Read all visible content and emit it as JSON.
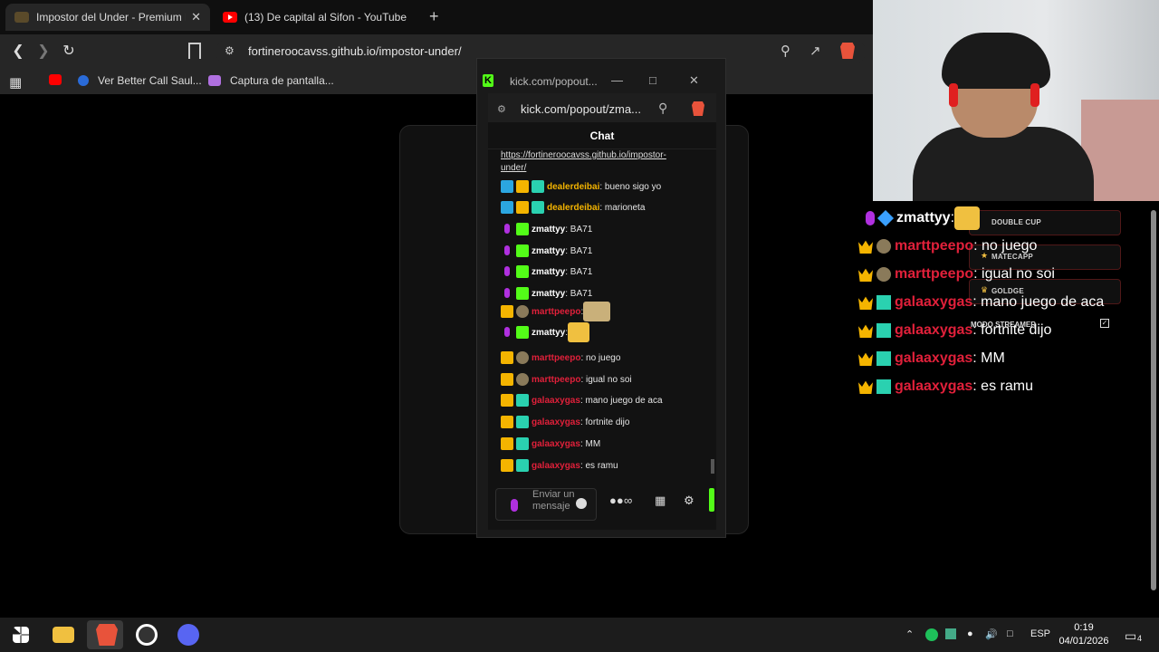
{
  "browser": {
    "tabs": [
      {
        "title": "Impostor del Under - Premium E",
        "close": "✕"
      },
      {
        "title": "(13) De capital al Sifon - YouTube"
      }
    ],
    "new_tab": "+",
    "url": "fortineroocavss.github.io/impostor-under/",
    "bookmarks": [
      {
        "label": "Ver Better Call Saul..."
      },
      {
        "label": "Captura de pantalla..."
      }
    ]
  },
  "popout": {
    "title": "kick.com/popout...",
    "url": "kick.com/popout/zma...",
    "chat_header": "Chat",
    "link_line1": "https://fortineroocavss.github.io/impostor-",
    "link_line2": "under/",
    "messages": [
      {
        "user": "dealerdeibai",
        "text": ": bueno sigo yo",
        "color": "#f4b400"
      },
      {
        "user": "dealerdeibai",
        "text": ": marioneta",
        "color": "#f4b400"
      },
      {
        "user": "zmattyy",
        "text": ": BA71",
        "color": "#ffffff"
      },
      {
        "user": "zmattyy",
        "text": ": BA71",
        "color": "#ffffff"
      },
      {
        "user": "zmattyy",
        "text": ": BA71",
        "color": "#ffffff"
      },
      {
        "user": "zmattyy",
        "text": ": BA71",
        "color": "#ffffff"
      },
      {
        "user": "marttpeepo",
        "text": ":",
        "color": "#e0203a"
      },
      {
        "user": "zmattyy",
        "text": ":",
        "color": "#ffffff"
      },
      {
        "user": "marttpeepo",
        "text": ": no juego",
        "color": "#e0203a"
      },
      {
        "user": "marttpeepo",
        "text": ": igual no soi",
        "color": "#e0203a"
      },
      {
        "user": "galaaxygas",
        "text": ": mano juego de aca",
        "color": "#e0203a"
      },
      {
        "user": "galaaxygas",
        "text": ": fortnite dijo",
        "color": "#e0203a"
      },
      {
        "user": "galaaxygas",
        "text": ": MM",
        "color": "#e0203a"
      },
      {
        "user": "galaaxygas",
        "text": ": es ramu",
        "color": "#e0203a"
      }
    ],
    "input_placeholder": "Enviar un mensaje"
  },
  "overlay": {
    "messages": [
      {
        "user": "zmattyy",
        "text": ":",
        "color": "#ffffff"
      },
      {
        "user": "marttpeepo",
        "text": ": no juego",
        "color": "#e0203a"
      },
      {
        "user": "marttpeepo",
        "text": ": igual no soi",
        "color": "#e0203a"
      },
      {
        "user": "galaaxygas",
        "text": ": mano juego de aca",
        "color": "#e0203a"
      },
      {
        "user": "galaaxygas",
        "text": ": fortnite dijo",
        "color": "#e0203a"
      },
      {
        "user": "galaaxygas",
        "text": ": MM",
        "color": "#e0203a"
      },
      {
        "user": "galaaxygas",
        "text": ": es ramu",
        "color": "#e0203a"
      }
    ],
    "goals": [
      "DOUBLE CUP",
      "MATECAPP",
      "GOLDGE"
    ],
    "streamer_mode": "MODO STREAMER"
  },
  "taskbar": {
    "lang": "ESP",
    "time": "0:19",
    "date": "04/01/2026",
    "notif_count": "4"
  },
  "colors": {
    "kick_green": "#53fc18",
    "username_red": "#e0203a",
    "username_gold": "#f4b400",
    "brave_orange": "#e8533b"
  }
}
